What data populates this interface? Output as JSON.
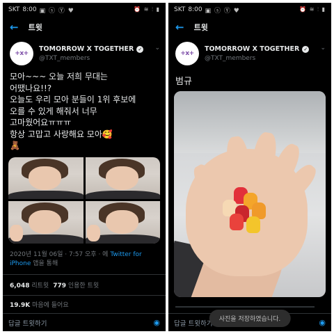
{
  "left": {
    "status": {
      "carrier": "SKT",
      "time": "8:00",
      "icons_left": "▣ ⓢ Ⓨ ♥",
      "icons_right": "⏰ ≋ ⫶ ▮"
    },
    "topbar": {
      "title": "트윗"
    },
    "author": {
      "avatar_text": "+x+",
      "display_name": "TOMORROW X TOGETHER",
      "handle": "@TXT_members"
    },
    "tweet_text": "모아~~~ 오늘 저희 무대는\n어땠나요!!?\n오늘도 우리 모아 분들이 1위 후보에\n오를 수 있게 해줘서 너무\n고마웠어요ㅠㅠㅠ\n항상 고맙고 사랑해요 모아🥰",
    "bear_emoji": "🧸",
    "meta": {
      "datetime": "2020년 11월 06일 · 7:57 오후 · 에",
      "client": "Twitter for iPhone",
      "via": "앱을 통해"
    },
    "stats": {
      "retweets": "6,048",
      "retweets_label": "리트윗",
      "quotes": "779",
      "quotes_label": "인용한 트윗",
      "likes": "19.9K",
      "likes_label": "마음에 들어요"
    },
    "reply_bar": {
      "placeholder": "답글 트윗하기"
    }
  },
  "right": {
    "status": {
      "carrier": "SKT",
      "time": "8:00",
      "icons_left": "▣ ⓢ Ⓨ ♥",
      "icons_right": "⏰ ≋ ⫶ ▮"
    },
    "topbar": {
      "title": "트윗"
    },
    "author": {
      "avatar_text": "+x+",
      "display_name": "TOMORROW X TOGETHER",
      "handle": "@TXT_members"
    },
    "tweet_text": "범규",
    "reply_bar": {
      "placeholder": "답글 트윗하기"
    },
    "toast": "사진을 저장하였습니다."
  },
  "colors": {
    "accent": "#1d9bf0",
    "background": "#000000",
    "text": "#e7e9ea",
    "muted": "#71767b"
  }
}
